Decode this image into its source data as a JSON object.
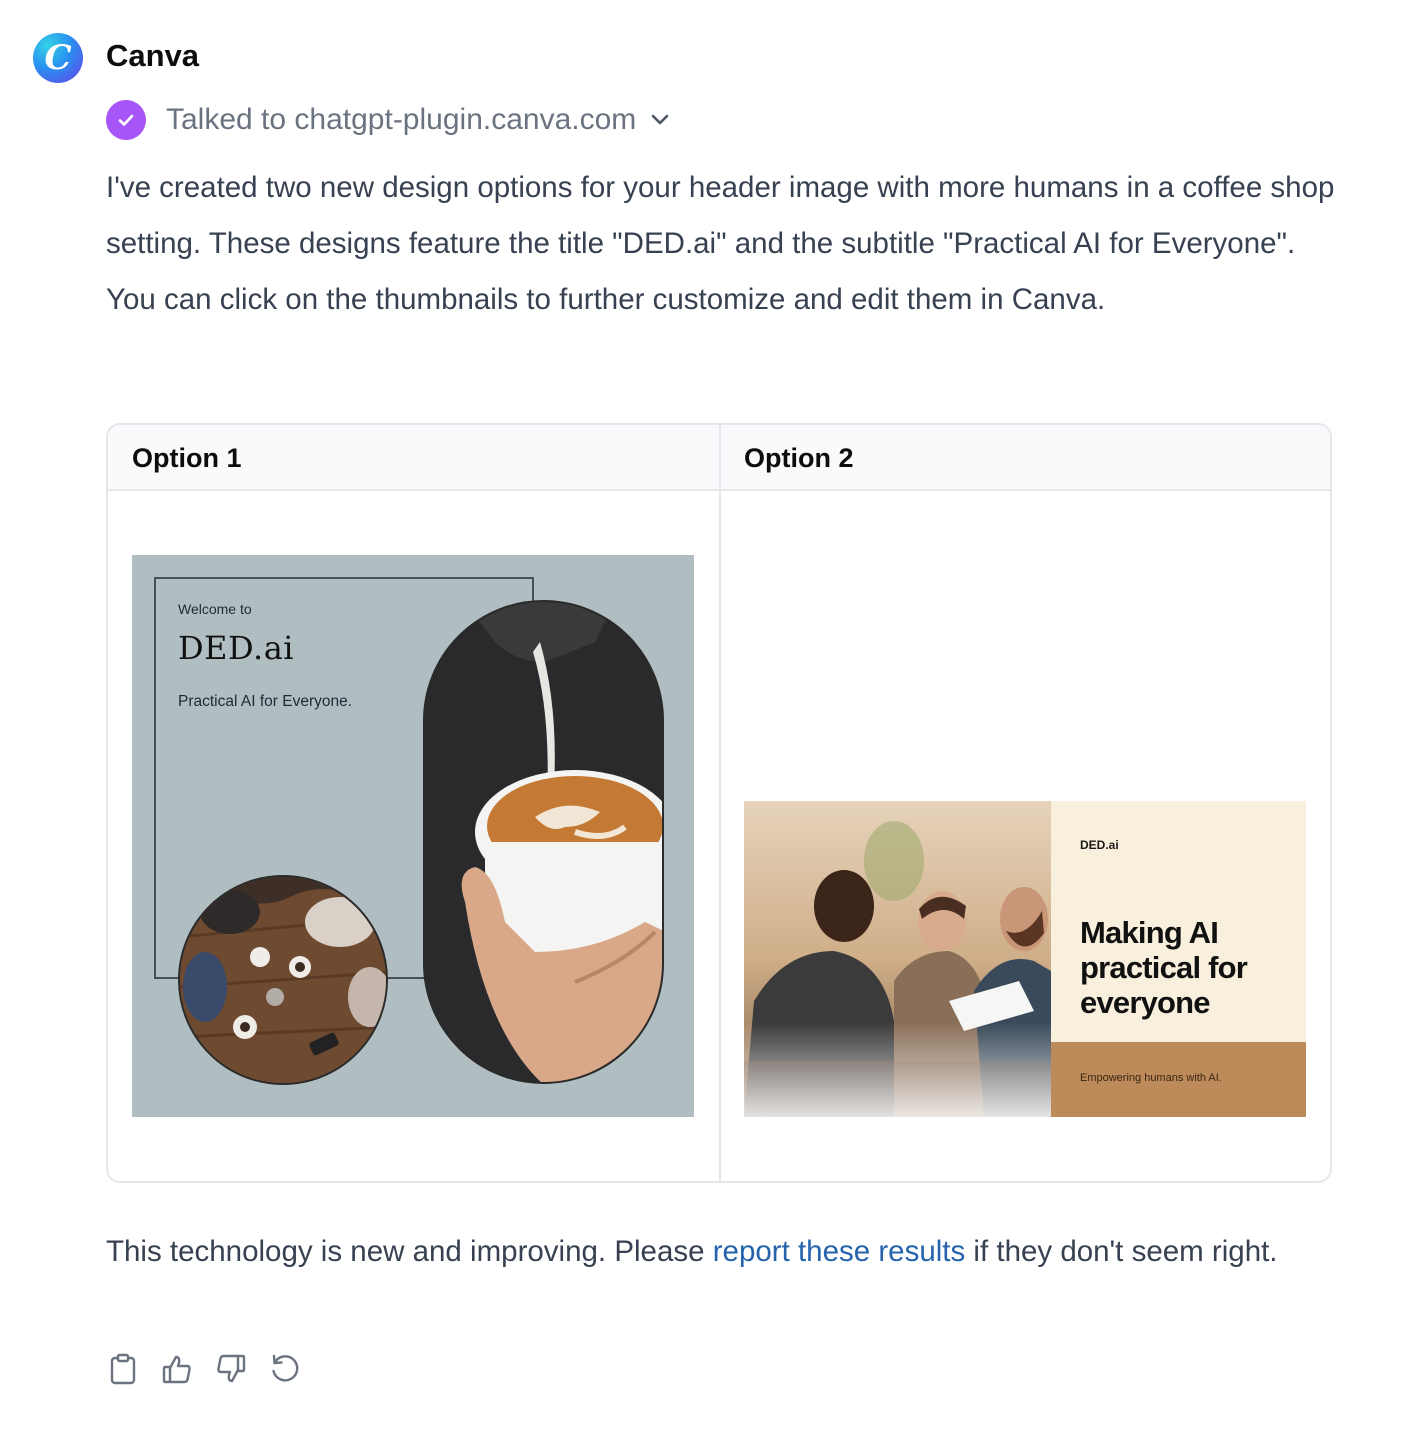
{
  "message": {
    "sender": "Canva",
    "avatar_letter": "C",
    "plugin_status": "Talked to chatgpt-plugin.canva.com",
    "body": "I've created two new design options for your header image with more humans in a coffee shop setting. These designs feature the title \"DED.ai\" and the subtitle \"Practical AI for Everyone\". You can click on the thumbnails to further customize and edit them in Canva."
  },
  "table": {
    "headers": [
      "Option 1",
      "Option 2"
    ],
    "option1": {
      "welcome": "Welcome to",
      "title": "DED.ai",
      "subtitle": "Practical AI for Everyone."
    },
    "option2": {
      "brand": "DED.ai",
      "headline": "Making AI practical for everyone",
      "tagline": "Empowering humans with AI."
    }
  },
  "footer": {
    "before_link": "This technology is new and improving. Please ",
    "link": "report these results",
    "after_link": " if they don't seem right."
  },
  "actions": [
    {
      "name": "copy",
      "icon": "clipboard-icon"
    },
    {
      "name": "thumbs-up",
      "icon": "thumbs-up-icon"
    },
    {
      "name": "thumbs-down",
      "icon": "thumbs-down-icon"
    },
    {
      "name": "regenerate",
      "icon": "refresh-icon"
    }
  ],
  "colors": {
    "accent_check": "#a855f7",
    "link": "#2563ac",
    "thumb1_bg": "#b0bec2",
    "thumb2_panel": "#f9efdd",
    "thumb2_footer": "#bd8a5a"
  }
}
